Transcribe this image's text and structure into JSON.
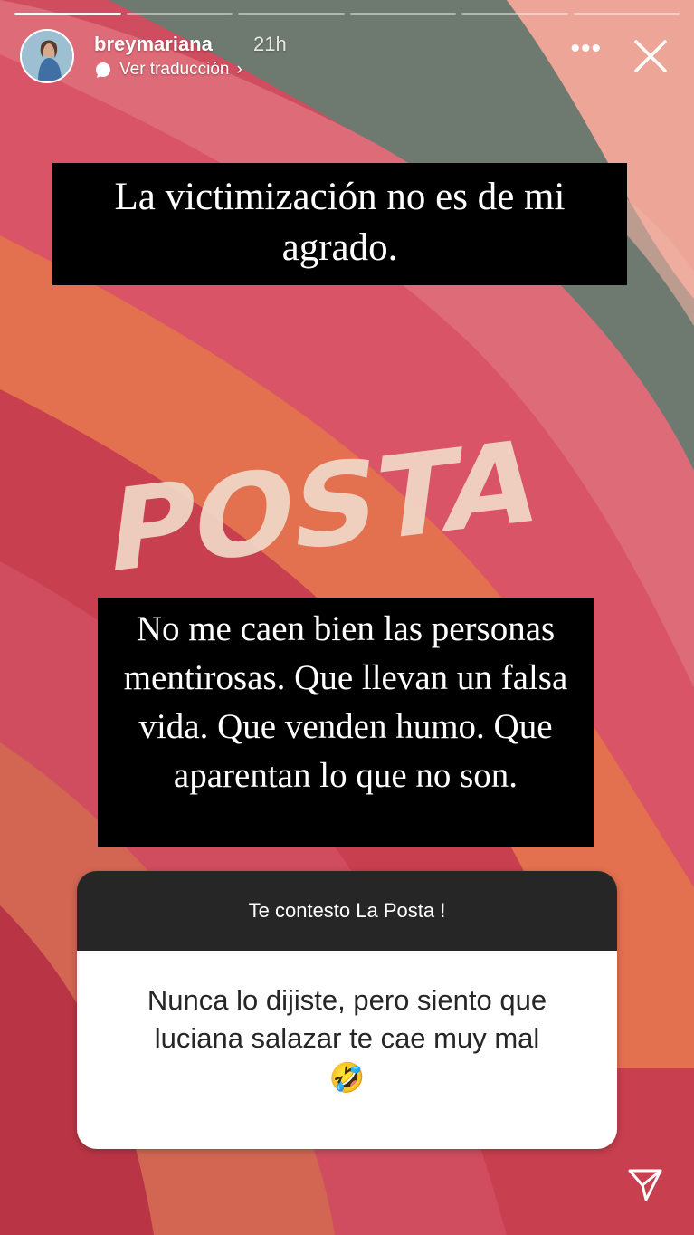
{
  "story": {
    "progress": {
      "total_segments": 6,
      "current": 1
    },
    "user": {
      "username": "breymariana",
      "time": "21h",
      "translate_label": "Ver traducción",
      "translate_chevron": "›"
    },
    "actions": {
      "more_label": "•••",
      "close_icon": "close-icon"
    },
    "caption_top": "La victimización no es de mi agrado.",
    "background_text": "POSTA",
    "caption_middle": "No me caen bien las personas mentirosas. Que llevan un falsa vida. Que venden humo. Que aparentan lo que no son.",
    "question_sticker": {
      "header": "Te contesto La Posta !",
      "body": "Nunca lo dijiste, pero siento que luciana salazar te cae muy mal",
      "emoji": "🤣"
    },
    "send_icon": "send-icon"
  },
  "colors": {
    "pink": "#d85a6f",
    "salmon": "#e98c7e",
    "gray_green": "#6f7b70",
    "orange": "#d96a45",
    "deep_red": "#c23a4b"
  }
}
